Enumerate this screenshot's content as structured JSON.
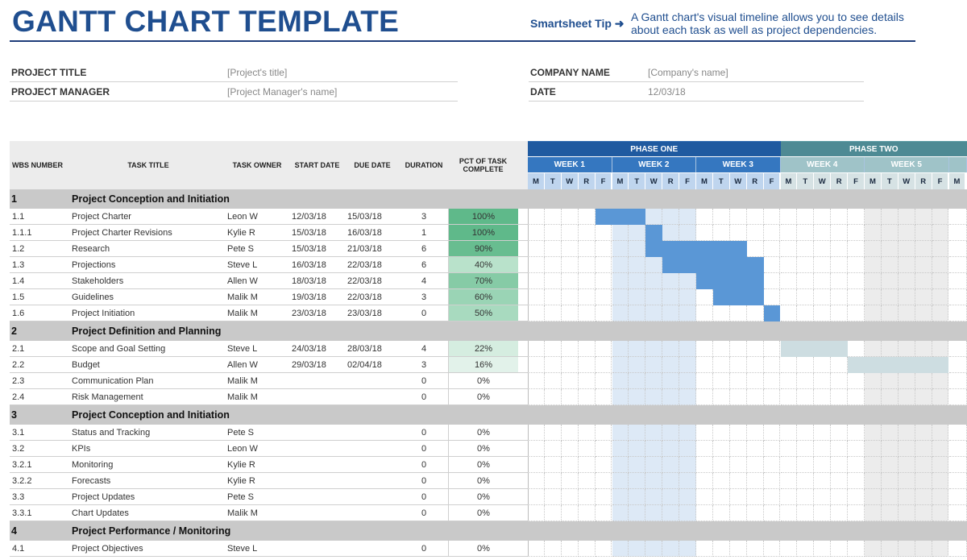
{
  "header": {
    "title": "GANTT CHART TEMPLATE",
    "tip_label": "Smartsheet Tip ➜",
    "tip_text": "A Gantt chart's visual timeline allows you to see details about each task as well as project dependencies."
  },
  "meta": {
    "project_title_label": "PROJECT TITLE",
    "project_title_value": "[Project's title]",
    "project_manager_label": "PROJECT MANAGER",
    "project_manager_value": "[Project Manager's name]",
    "company_name_label": "COMPANY NAME",
    "company_name_value": "[Company's name]",
    "date_label": "DATE",
    "date_value": "12/03/18"
  },
  "columns": {
    "wbs": "WBS NUMBER",
    "title": "TASK TITLE",
    "owner": "TASK OWNER",
    "start": "START DATE",
    "due": "DUE DATE",
    "duration": "DURATION",
    "pct": "PCT OF TASK COMPLETE"
  },
  "colors": {
    "phase_one": "#1f5aa0",
    "phase_two": "#4e8a94",
    "week_phase_one": "#3577c0",
    "week_phase_two": "#9fc3c8",
    "day_phase_one": "#bfd5ee",
    "day_phase_two": "#d6e2e4",
    "bar_phase_one": "#5a97d6",
    "bar_phase_two": "#cddde1",
    "week2_shade": "#dde9f6",
    "week5_shade": "#ececec"
  },
  "chart_data": {
    "type": "gantt",
    "title": "GANTT CHART TEMPLATE",
    "phases": [
      {
        "name": "PHASE ONE",
        "weeks": [
          "WEEK 1",
          "WEEK 2",
          "WEEK 3"
        ]
      },
      {
        "name": "PHASE TWO",
        "weeks": [
          "WEEK 4",
          "WEEK 5"
        ]
      }
    ],
    "days": [
      "M",
      "T",
      "W",
      "R",
      "F",
      "M",
      "T",
      "W",
      "R",
      "F",
      "M",
      "T",
      "W",
      "R",
      "F",
      "M",
      "T",
      "W",
      "R",
      "F",
      "M",
      "T",
      "W",
      "R",
      "F",
      "M"
    ],
    "sections": [
      {
        "wbs": "1",
        "title": "Project Conception and Initiation",
        "tasks": [
          {
            "wbs": "1.1",
            "title": "Project Charter",
            "owner": "Leon W",
            "start": "12/03/18",
            "due": "15/03/18",
            "duration": "3",
            "pct": "100%",
            "pct_value": 100,
            "bar_start_day": 4,
            "bar_end_day": 6,
            "phase": 1
          },
          {
            "wbs": "1.1.1",
            "title": "Project Charter Revisions",
            "owner": "Kylie R",
            "start": "15/03/18",
            "due": "16/03/18",
            "duration": "1",
            "pct": "100%",
            "pct_value": 100,
            "bar_start_day": 7,
            "bar_end_day": 7,
            "phase": 1
          },
          {
            "wbs": "1.2",
            "title": "Research",
            "owner": "Pete S",
            "start": "15/03/18",
            "due": "21/03/18",
            "duration": "6",
            "pct": "90%",
            "pct_value": 90,
            "bar_start_day": 7,
            "bar_end_day": 12,
            "phase": 1
          },
          {
            "wbs": "1.3",
            "title": "Projections",
            "owner": "Steve L",
            "start": "16/03/18",
            "due": "22/03/18",
            "duration": "6",
            "pct": "40%",
            "pct_value": 40,
            "bar_start_day": 8,
            "bar_end_day": 13,
            "phase": 1
          },
          {
            "wbs": "1.4",
            "title": "Stakeholders",
            "owner": "Allen W",
            "start": "18/03/18",
            "due": "22/03/18",
            "duration": "4",
            "pct": "70%",
            "pct_value": 70,
            "bar_start_day": 10,
            "bar_end_day": 13,
            "phase": 1
          },
          {
            "wbs": "1.5",
            "title": "Guidelines",
            "owner": "Malik M",
            "start": "19/03/18",
            "due": "22/03/18",
            "duration": "3",
            "pct": "60%",
            "pct_value": 60,
            "bar_start_day": 11,
            "bar_end_day": 13,
            "phase": 1
          },
          {
            "wbs": "1.6",
            "title": "Project Initiation",
            "owner": "Malik M",
            "start": "23/03/18",
            "due": "23/03/18",
            "duration": "0",
            "pct": "50%",
            "pct_value": 50,
            "bar_start_day": 14,
            "bar_end_day": 14,
            "phase": 1
          }
        ]
      },
      {
        "wbs": "2",
        "title": "Project Definition and Planning",
        "tasks": [
          {
            "wbs": "2.1",
            "title": "Scope and Goal Setting",
            "owner": "Steve L",
            "start": "24/03/18",
            "due": "28/03/18",
            "duration": "4",
            "pct": "22%",
            "pct_value": 22,
            "bar_start_day": 15,
            "bar_end_day": 18,
            "phase": 2
          },
          {
            "wbs": "2.2",
            "title": "Budget",
            "owner": "Allen W",
            "start": "29/03/18",
            "due": "02/04/18",
            "duration": "3",
            "pct": "16%",
            "pct_value": 16,
            "bar_start_day": 19,
            "bar_end_day": 24,
            "phase": 2
          },
          {
            "wbs": "2.3",
            "title": "Communication Plan",
            "owner": "Malik M",
            "start": "",
            "due": "",
            "duration": "0",
            "pct": "0%",
            "pct_value": 0
          },
          {
            "wbs": "2.4",
            "title": "Risk Management",
            "owner": "Malik M",
            "start": "",
            "due": "",
            "duration": "0",
            "pct": "0%",
            "pct_value": 0
          }
        ]
      },
      {
        "wbs": "3",
        "title": "Project Conception and Initiation",
        "tasks": [
          {
            "wbs": "3.1",
            "title": "Status and Tracking",
            "owner": "Pete S",
            "start": "",
            "due": "",
            "duration": "0",
            "pct": "0%",
            "pct_value": 0
          },
          {
            "wbs": "3.2",
            "title": "KPIs",
            "owner": "Leon W",
            "start": "",
            "due": "",
            "duration": "0",
            "pct": "0%",
            "pct_value": 0
          },
          {
            "wbs": "3.2.1",
            "title": "Monitoring",
            "owner": "Kylie R",
            "start": "",
            "due": "",
            "duration": "0",
            "pct": "0%",
            "pct_value": 0
          },
          {
            "wbs": "3.2.2",
            "title": "Forecasts",
            "owner": "Kylie R",
            "start": "",
            "due": "",
            "duration": "0",
            "pct": "0%",
            "pct_value": 0
          },
          {
            "wbs": "3.3",
            "title": "Project Updates",
            "owner": "Pete S",
            "start": "",
            "due": "",
            "duration": "0",
            "pct": "0%",
            "pct_value": 0
          },
          {
            "wbs": "3.3.1",
            "title": "Chart Updates",
            "owner": "Malik M",
            "start": "",
            "due": "",
            "duration": "0",
            "pct": "0%",
            "pct_value": 0
          }
        ]
      },
      {
        "wbs": "4",
        "title": "Project Performance / Monitoring",
        "tasks": [
          {
            "wbs": "4.1",
            "title": "Project Objectives",
            "owner": "Steve L",
            "start": "",
            "due": "",
            "duration": "0",
            "pct": "0%",
            "pct_value": 0
          }
        ]
      }
    ]
  }
}
